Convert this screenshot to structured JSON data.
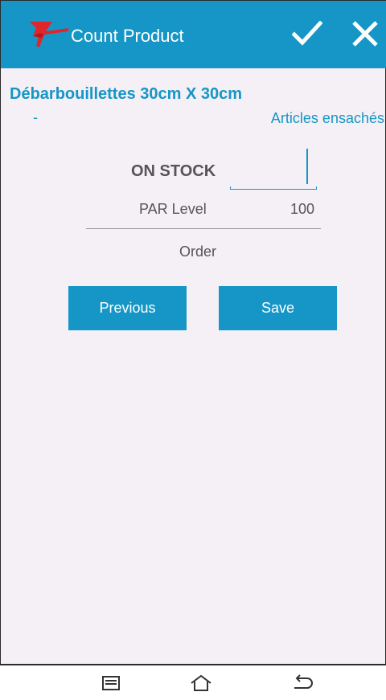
{
  "app_bar": {
    "title": "Count Product",
    "icons": {
      "logo": "arrow-logo-icon",
      "confirm": "checkmark-icon",
      "close": "close-icon"
    },
    "colors": {
      "background": "#1596c6",
      "foreground": "#ffffff",
      "logo": "#e0262b"
    }
  },
  "product": {
    "name": "Débarbouillettes 30cm X 30cm",
    "code": "-",
    "category": "Articles ensachés"
  },
  "count": {
    "on_stock_label": "ON STOCK",
    "on_stock_value": "",
    "par_level_label": "PAR Level",
    "par_level_value": "100",
    "order_label": "Order"
  },
  "buttons": {
    "previous_label": "Previous",
    "save_label": "Save"
  },
  "system_nav": {
    "icons": [
      "menu-icon",
      "home-icon",
      "back-icon"
    ]
  }
}
